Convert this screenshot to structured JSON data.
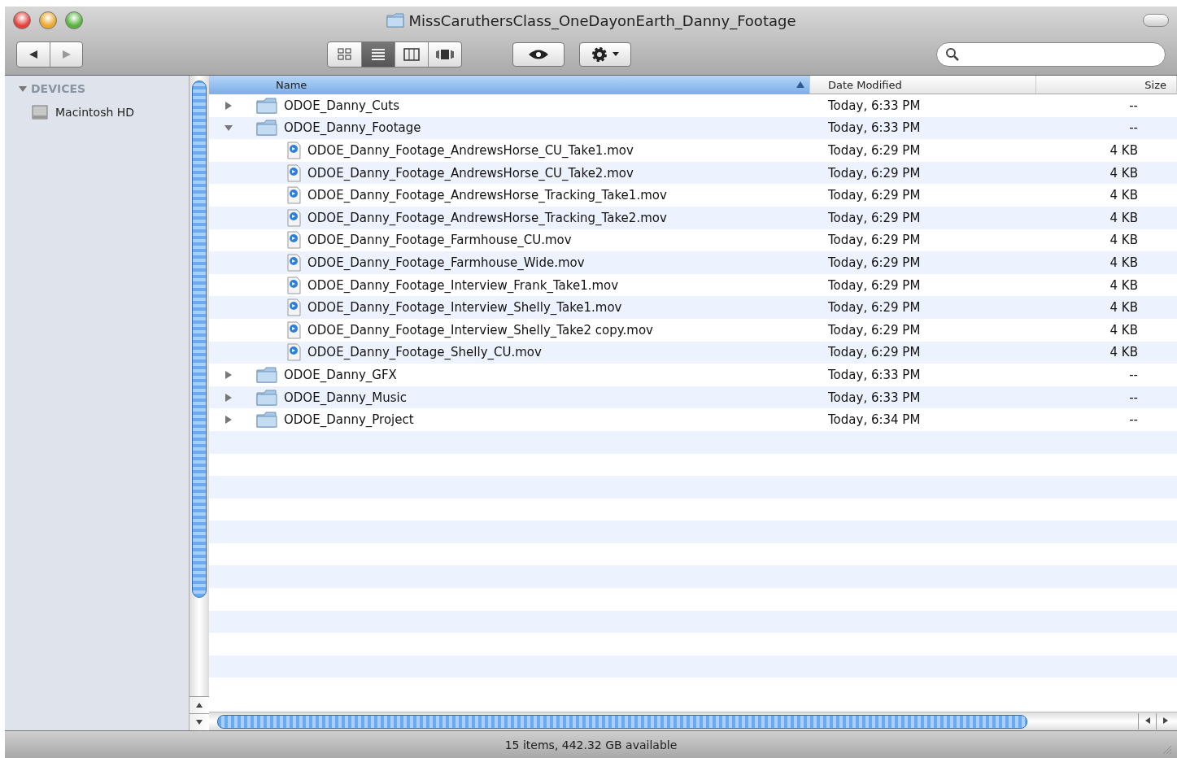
{
  "window": {
    "title": "MissCaruthersClass_OneDayonEarth_Danny_Footage"
  },
  "toolbar": {
    "view_buttons": [
      {
        "kind": "icon",
        "selected": false
      },
      {
        "kind": "list",
        "selected": true
      },
      {
        "kind": "columns",
        "selected": false
      },
      {
        "kind": "coverflow",
        "selected": false
      }
    ]
  },
  "sidebar": {
    "section": {
      "label": "DEVICES",
      "expanded": true
    },
    "items": [
      {
        "label": "Macintosh HD"
      }
    ]
  },
  "table": {
    "columns": [
      {
        "label": "Name",
        "sorted": true
      },
      {
        "label": "Date Modified",
        "sorted": false
      },
      {
        "label": "Size",
        "sorted": false
      }
    ],
    "rows": [
      {
        "kind": "folder",
        "name": "ODOE_Danny_Cuts",
        "date": "Today, 6:33 PM",
        "size": "--",
        "expanded": false
      },
      {
        "kind": "folder",
        "name": "ODOE_Danny_Footage",
        "date": "Today, 6:33 PM",
        "size": "--",
        "expanded": true,
        "children": [
          {
            "kind": "movie",
            "name": "ODOE_Danny_Footage_AndrewsHorse_CU_Take1.mov",
            "date": "Today, 6:29 PM",
            "size": "4 KB"
          },
          {
            "kind": "movie",
            "name": "ODOE_Danny_Footage_AndrewsHorse_CU_Take2.mov",
            "date": "Today, 6:29 PM",
            "size": "4 KB"
          },
          {
            "kind": "movie",
            "name": "ODOE_Danny_Footage_AndrewsHorse_Tracking_Take1.mov",
            "date": "Today, 6:29 PM",
            "size": "4 KB"
          },
          {
            "kind": "movie",
            "name": "ODOE_Danny_Footage_AndrewsHorse_Tracking_Take2.mov",
            "date": "Today, 6:29 PM",
            "size": "4 KB"
          },
          {
            "kind": "movie",
            "name": "ODOE_Danny_Footage_Farmhouse_CU.mov",
            "date": "Today, 6:29 PM",
            "size": "4 KB"
          },
          {
            "kind": "movie",
            "name": "ODOE_Danny_Footage_Farmhouse_Wide.mov",
            "date": "Today, 6:29 PM",
            "size": "4 KB"
          },
          {
            "kind": "movie",
            "name": "ODOE_Danny_Footage_Interview_Frank_Take1.mov",
            "date": "Today, 6:29 PM",
            "size": "4 KB"
          },
          {
            "kind": "movie",
            "name": "ODOE_Danny_Footage_Interview_Shelly_Take1.mov",
            "date": "Today, 6:29 PM",
            "size": "4 KB"
          },
          {
            "kind": "movie",
            "name": "ODOE_Danny_Footage_Interview_Shelly_Take2 copy.mov",
            "date": "Today, 6:29 PM",
            "size": "4 KB"
          },
          {
            "kind": "movie",
            "name": "ODOE_Danny_Footage_Shelly_CU.mov",
            "date": "Today, 6:29 PM",
            "size": "4 KB"
          }
        ]
      },
      {
        "kind": "folder",
        "name": "ODOE_Danny_GFX",
        "date": "Today, 6:33 PM",
        "size": "--",
        "expanded": false
      },
      {
        "kind": "folder",
        "name": "ODOE_Danny_Music",
        "date": "Today, 6:33 PM",
        "size": "--",
        "expanded": false
      },
      {
        "kind": "folder",
        "name": "ODOE_Danny_Project",
        "date": "Today, 6:34 PM",
        "size": "--",
        "expanded": false
      }
    ]
  },
  "status_bar": {
    "text": "15 items, 442.32 GB available"
  }
}
